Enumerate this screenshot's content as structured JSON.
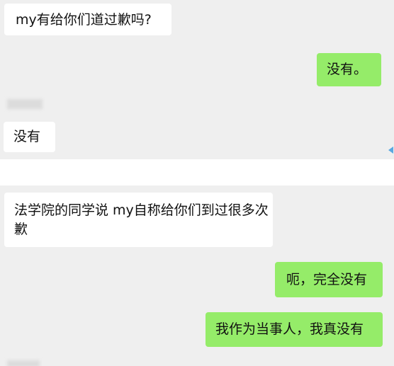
{
  "chat": {
    "screen1": {
      "messages": [
        {
          "side": "left",
          "text": "my有给你们道过歉吗?"
        },
        {
          "side": "right",
          "text": "没有。"
        },
        {
          "side": "left",
          "text": "没有"
        }
      ]
    },
    "screen2": {
      "messages": [
        {
          "side": "left",
          "text": "法学院的同学说 my自称给你们到过很多次歉"
        },
        {
          "side": "right",
          "text": "呃，完全没有"
        },
        {
          "side": "right",
          "text": "我作为当事人，我真没有"
        }
      ]
    }
  },
  "colors": {
    "chat_background": "#efefef",
    "incoming_bubble": "#ffffff",
    "outgoing_bubble": "#95ec69",
    "edge_arrow": "#5aa8e0"
  },
  "icons": {
    "edge_marker": "left-pointing-triangle"
  }
}
